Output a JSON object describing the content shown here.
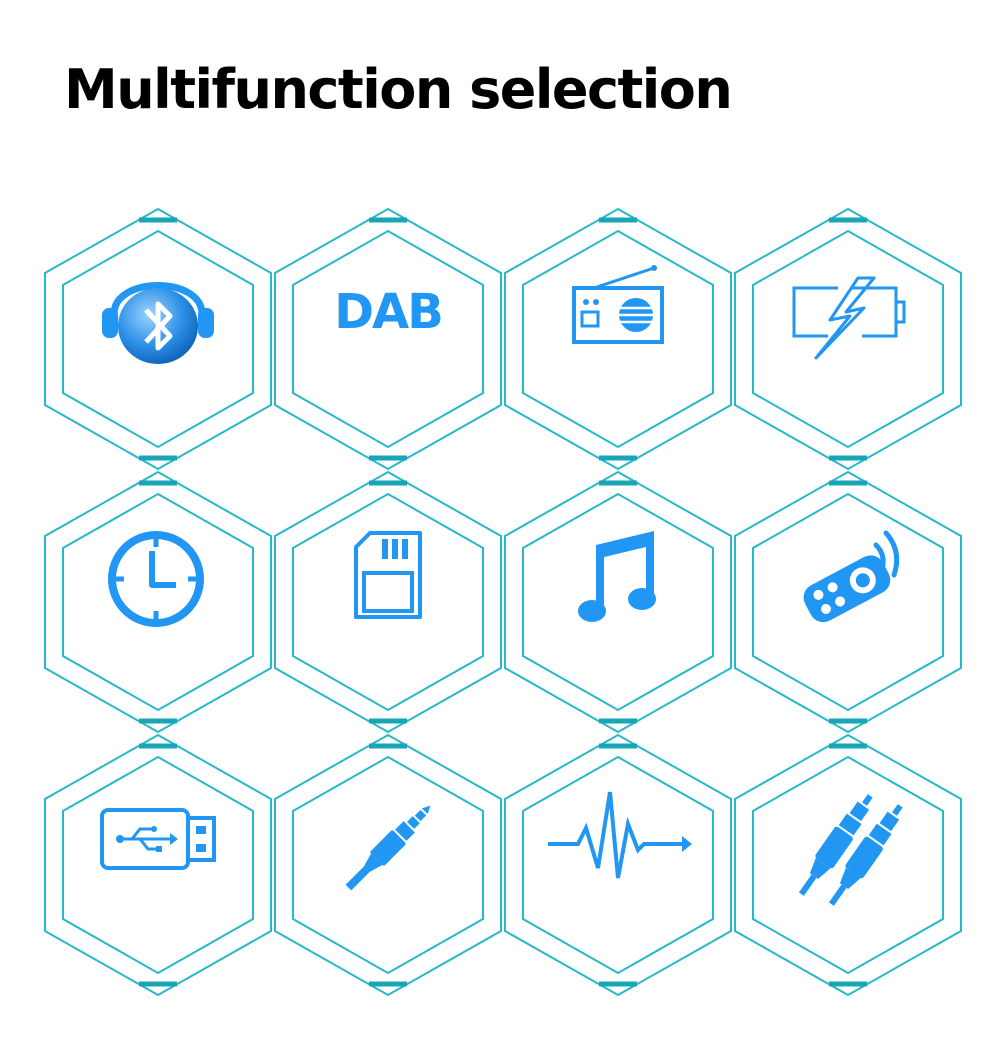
{
  "title": "Multifunction selection",
  "colors": {
    "hex_outline": "#27b8c9",
    "hex_accent": "#1aa5b6",
    "icon_blue": "#2196f3"
  },
  "tiles": [
    {
      "icon": "bluetooth-headphones-icon"
    },
    {
      "icon": "dab-logo",
      "text": "DAB"
    },
    {
      "icon": "radio-icon"
    },
    {
      "icon": "battery-charging-icon"
    },
    {
      "icon": "clock-icon"
    },
    {
      "icon": "sd-card-icon"
    },
    {
      "icon": "music-note-icon"
    },
    {
      "icon": "remote-control-icon"
    },
    {
      "icon": "usb-drive-icon"
    },
    {
      "icon": "aux-audio-jack-icon"
    },
    {
      "icon": "audio-waveform-icon"
    },
    {
      "icon": "rca-cable-icon"
    }
  ]
}
